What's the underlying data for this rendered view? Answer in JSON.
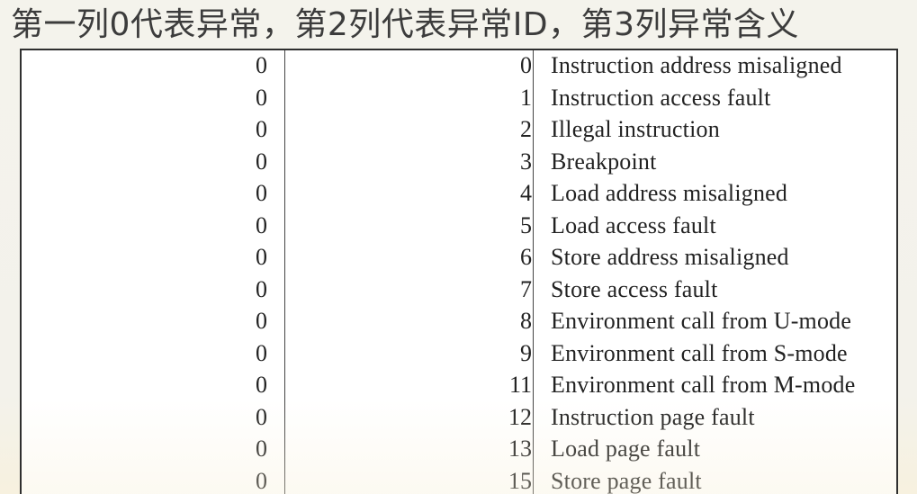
{
  "heading": "第一列0代表异常，第2列代表异常ID，第3列异常含义",
  "table": {
    "rows": [
      {
        "interrupt": "0",
        "code": "0",
        "description": "Instruction address misaligned"
      },
      {
        "interrupt": "0",
        "code": "1",
        "description": "Instruction access fault"
      },
      {
        "interrupt": "0",
        "code": "2",
        "description": "Illegal instruction"
      },
      {
        "interrupt": "0",
        "code": "3",
        "description": "Breakpoint"
      },
      {
        "interrupt": "0",
        "code": "4",
        "description": "Load address misaligned"
      },
      {
        "interrupt": "0",
        "code": "5",
        "description": "Load access fault"
      },
      {
        "interrupt": "0",
        "code": "6",
        "description": "Store address misaligned"
      },
      {
        "interrupt": "0",
        "code": "7",
        "description": "Store access fault"
      },
      {
        "interrupt": "0",
        "code": "8",
        "description": "Environment call from U-mode"
      },
      {
        "interrupt": "0",
        "code": "9",
        "description": "Environment call from S-mode"
      },
      {
        "interrupt": "0",
        "code": "11",
        "description": "Environment call from M-mode"
      },
      {
        "interrupt": "0",
        "code": "12",
        "description": "Instruction page fault"
      },
      {
        "interrupt": "0",
        "code": "13",
        "description": "Load page fault"
      },
      {
        "interrupt": "0",
        "code": "15",
        "description": "Store page fault"
      }
    ]
  }
}
